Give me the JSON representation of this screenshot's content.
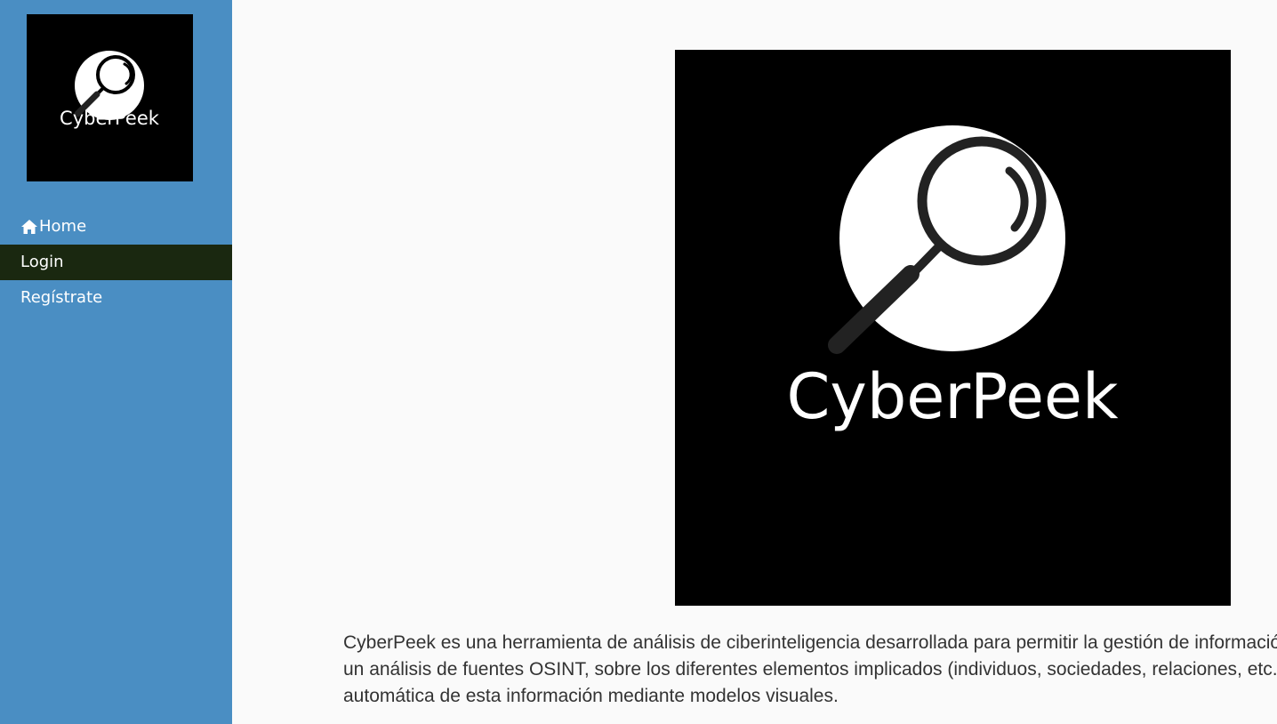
{
  "brand": {
    "name": "CyberPeek",
    "logo_icon": "magnifying-glass-icon",
    "logo_bg": "#000000",
    "logo_fg": "#ffffff"
  },
  "sidebar": {
    "bg_color": "#4a8ec3",
    "items": [
      {
        "label": "Home",
        "icon": "home-icon",
        "active": false
      },
      {
        "label": "Login",
        "active": true,
        "active_bg": "#1a2810"
      },
      {
        "label": "Regístrate",
        "active": false
      }
    ]
  },
  "main": {
    "description_lines": [
      "CyberPeek es una herramienta de análisis de ciberinteligencia desarrollada para permitir la gestión de información",
      "un análisis de fuentes OSINT, sobre los diferentes elementos implicados (individuos, sociedades, relaciones, etc.)",
      "automática de esta información mediante modelos visuales."
    ]
  }
}
